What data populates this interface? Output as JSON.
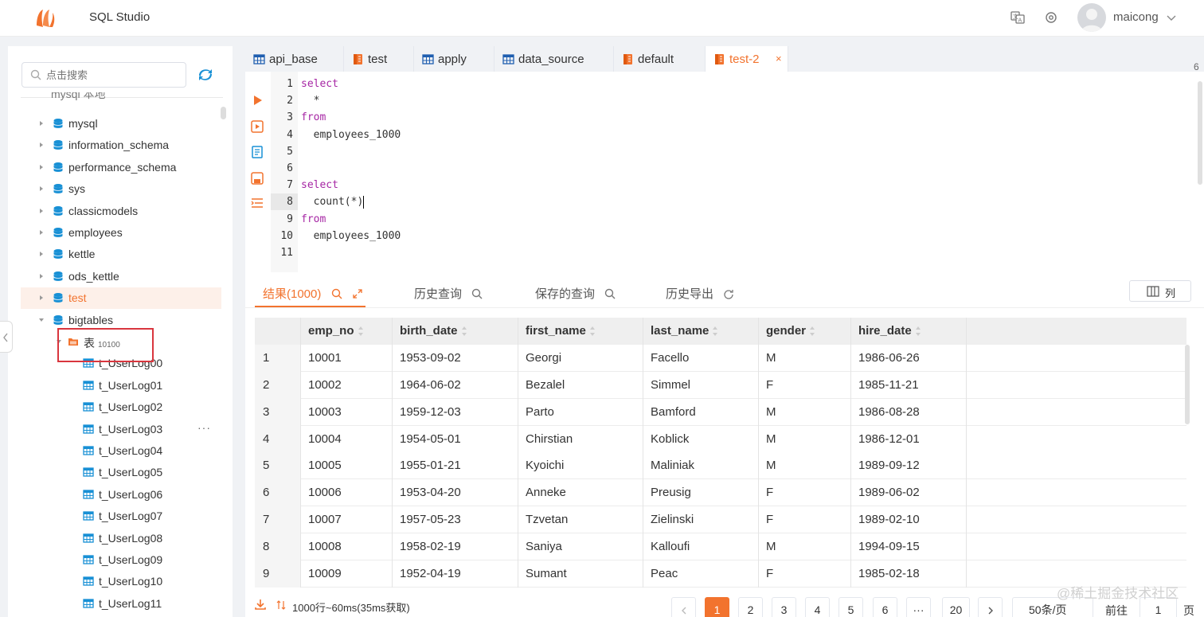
{
  "app": {
    "title": "SQL Studio",
    "user_name": "maicong",
    "brand_color": "#f2732e"
  },
  "sidebar": {
    "search_placeholder": "点击搜索",
    "partial_top_item": "mysql 本地",
    "databases": [
      {
        "label": "mysql"
      },
      {
        "label": "information_schema"
      },
      {
        "label": "performance_schema"
      },
      {
        "label": "sys"
      },
      {
        "label": "classicmodels"
      },
      {
        "label": "employees"
      },
      {
        "label": "kettle"
      },
      {
        "label": "ods_kettle"
      },
      {
        "label": "test",
        "selected": true
      },
      {
        "label": "bigtables",
        "expanded": true
      }
    ],
    "folder": {
      "label": "表",
      "count": "10100"
    },
    "tables": [
      {
        "label": "t_UserLog00"
      },
      {
        "label": "t_UserLog01"
      },
      {
        "label": "t_UserLog02"
      },
      {
        "label": "t_UserLog03",
        "more": "···"
      },
      {
        "label": "t_UserLog04"
      },
      {
        "label": "t_UserLog05"
      },
      {
        "label": "t_UserLog06"
      },
      {
        "label": "t_UserLog07"
      },
      {
        "label": "t_UserLog08"
      },
      {
        "label": "t_UserLog09"
      },
      {
        "label": "t_UserLog10"
      },
      {
        "label": "t_UserLog11"
      }
    ]
  },
  "tabs": [
    {
      "label": "api_base",
      "icon": "table-icon"
    },
    {
      "label": "test",
      "icon": "query-icon"
    },
    {
      "label": "apply",
      "icon": "table-icon"
    },
    {
      "label": "data_source",
      "icon": "table-icon"
    },
    {
      "label": "default",
      "icon": "query-icon"
    },
    {
      "label": "test-2",
      "icon": "query-icon",
      "active": true,
      "close": "×"
    }
  ],
  "tab_overflow_count": "6",
  "editor": {
    "line_numbers": [
      "1",
      "2",
      "3",
      "4",
      "5",
      "6",
      "7",
      "8",
      "9",
      "10",
      "11"
    ],
    "active_line": 8,
    "lines": [
      {
        "kw": "select",
        "text": ""
      },
      {
        "kw": "",
        "text": "  *"
      },
      {
        "kw": "from",
        "text": ""
      },
      {
        "kw": "",
        "text": "  employees_1000"
      },
      {
        "kw": "",
        "text": ""
      },
      {
        "kw": "",
        "text": ""
      },
      {
        "kw": "select",
        "text": ""
      },
      {
        "kw": "",
        "text": "  count(*)"
      },
      {
        "kw": "from",
        "text": ""
      },
      {
        "kw": "",
        "text": "  employees_1000"
      },
      {
        "kw": "",
        "text": ""
      }
    ]
  },
  "results": {
    "tabs": [
      {
        "label": "结果(1000)",
        "active": true
      },
      {
        "label": "历史查询"
      },
      {
        "label": "保存的查询"
      },
      {
        "label": "历史导出"
      }
    ],
    "columns_button": "列",
    "columns": [
      "",
      "emp_no",
      "birth_date",
      "first_name",
      "last_name",
      "gender",
      "hire_date"
    ],
    "rows": [
      [
        "1",
        "10001",
        "1953-09-02",
        "Georgi",
        "Facello",
        "M",
        "1986-06-26"
      ],
      [
        "2",
        "10002",
        "1964-06-02",
        "Bezalel",
        "Simmel",
        "F",
        "1985-11-21"
      ],
      [
        "3",
        "10003",
        "1959-12-03",
        "Parto",
        "Bamford",
        "M",
        "1986-08-28"
      ],
      [
        "4",
        "10004",
        "1954-05-01",
        "Chirstian",
        "Koblick",
        "M",
        "1986-12-01"
      ],
      [
        "5",
        "10005",
        "1955-01-21",
        "Kyoichi",
        "Maliniak",
        "M",
        "1989-09-12"
      ],
      [
        "6",
        "10006",
        "1953-04-20",
        "Anneke",
        "Preusig",
        "F",
        "1989-06-02"
      ],
      [
        "7",
        "10007",
        "1957-05-23",
        "Tzvetan",
        "Zielinski",
        "F",
        "1989-02-10"
      ],
      [
        "8",
        "10008",
        "1958-02-19",
        "Saniya",
        "Kalloufi",
        "M",
        "1994-09-15"
      ],
      [
        "9",
        "10009",
        "1952-04-19",
        "Sumant",
        "Peac",
        "F",
        "1985-02-18"
      ]
    ],
    "status": "1000行~60ms(35ms获取)"
  },
  "pagination": {
    "pages": [
      "1",
      "2",
      "3",
      "4",
      "5",
      "6",
      "···",
      "20"
    ],
    "current": "1",
    "page_size": "50条/页",
    "goto_label": "前往",
    "goto_value": "1",
    "page_suffix": "页"
  },
  "watermark": "@稀土掘金技术社区"
}
